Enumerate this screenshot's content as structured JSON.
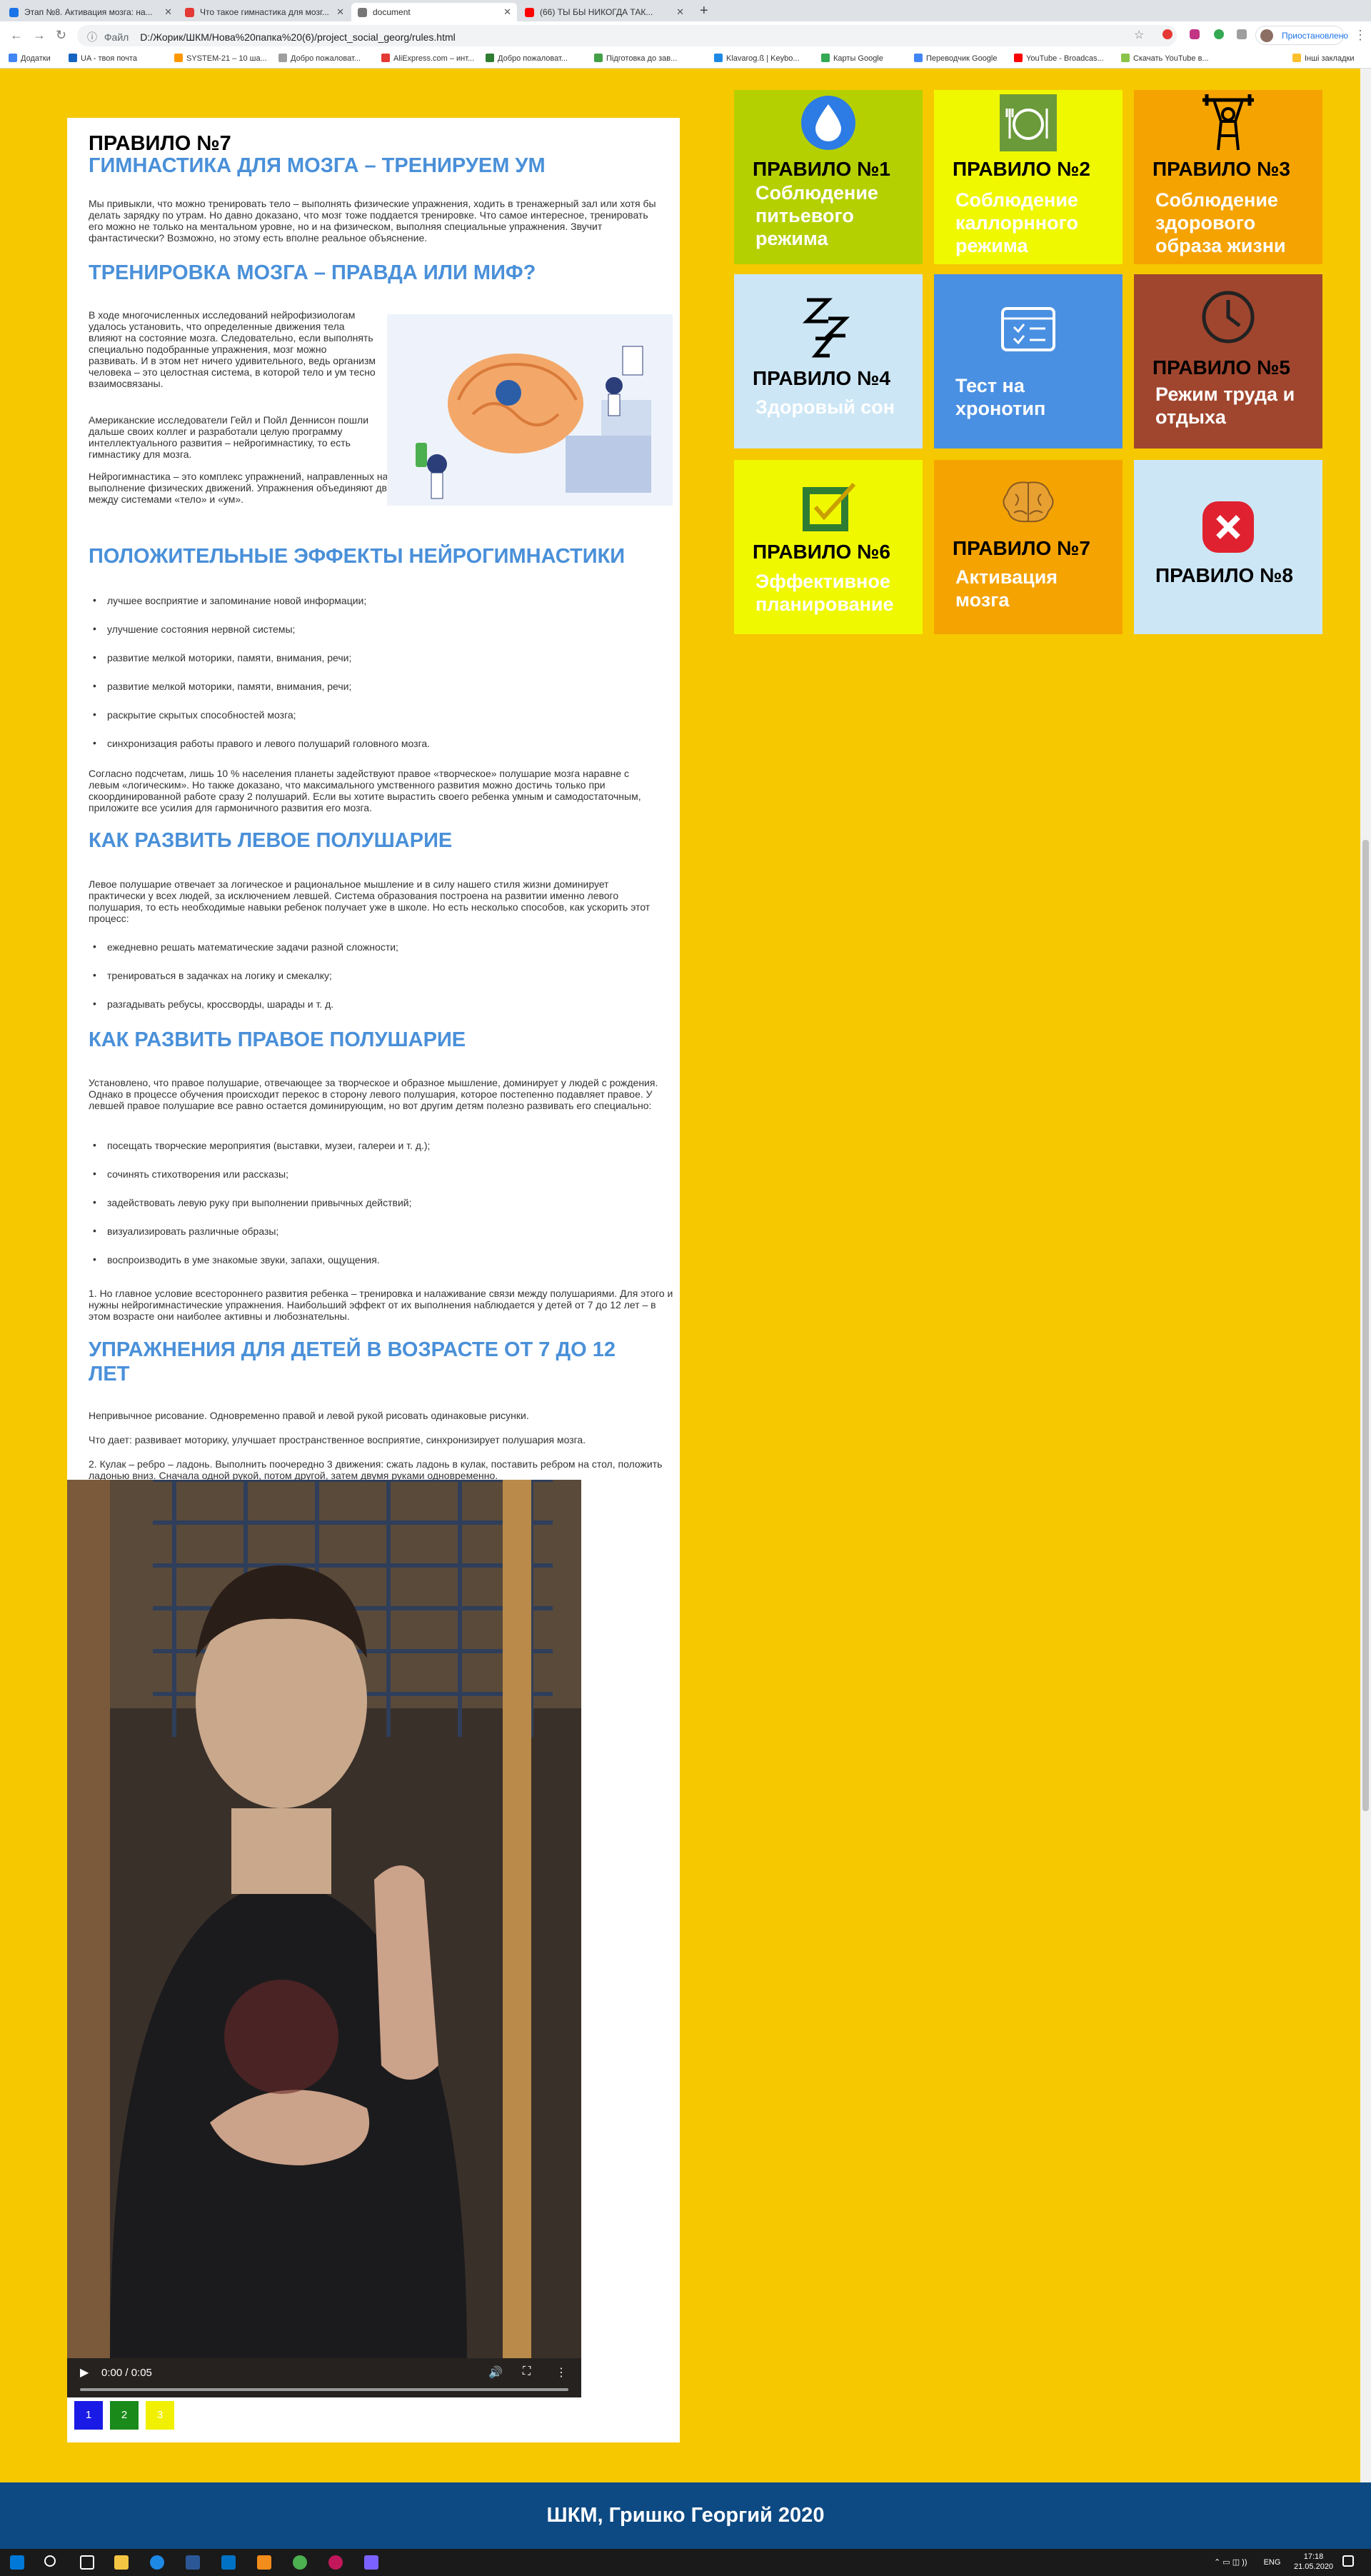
{
  "browser": {
    "tabs": [
      {
        "label": "Этап №8. Активация мозга: на...",
        "active": false,
        "color": "#1a73e8"
      },
      {
        "label": "Что такое гимнастика для мозг...",
        "active": false,
        "color": "#e53935"
      },
      {
        "label": "document",
        "active": true,
        "color": "#777777"
      },
      {
        "label": "(66) ТЫ БЫ НИКОГДА ТАК...",
        "active": false,
        "color": "#ff0000"
      }
    ],
    "new_tab": "+",
    "address_label": "Файл",
    "address": "D:/Жорик/ШКМ/Нова%20папка%20(6)/project_social_georg/rules.html",
    "profile": "Приостановлено",
    "bookmarks": [
      {
        "label": "Додатки",
        "color": "#4285f4"
      },
      {
        "label": "UA - твоя почта",
        "color": "#1565c0"
      },
      {
        "label": "SYSTEM-21 – 10 ша...",
        "color": "#ff9800"
      },
      {
        "label": "Добро пожаловат...",
        "color": "#9e9e9e"
      },
      {
        "label": "AliExpress.com – инт...",
        "color": "#e53935"
      },
      {
        "label": "Добро пожаловат...",
        "color": "#2e7d32"
      },
      {
        "label": "Підготовка до зав...",
        "color": "#43a047"
      },
      {
        "label": "Klavarog.ß | Keybo...",
        "color": "#1e88e5"
      },
      {
        "label": "Карты Google",
        "color": "#34a853"
      },
      {
        "label": "Переводчик Google",
        "color": "#4285f4"
      },
      {
        "label": "YouTube - Broadcas...",
        "color": "#ff0000"
      },
      {
        "label": "Скачать YouTube в...",
        "color": "#8bc34a"
      },
      {
        "label": "Інші закладки",
        "color": "#fbc02d"
      }
    ]
  },
  "article": {
    "rule_title": "ПРАВИЛО №7",
    "subtitle": "ГИМНАСТИКА ДЛЯ МОЗГА – ТРЕНИРУЕМ УМ",
    "intro": "Мы привыкли, что можно тренировать тело – выполнять физические упражнения, ходить в тренажерный зал или хотя бы делать зарядку по утрам. Но давно доказано, что мозг тоже поддается тренировке. Что самое интересное, тренировать его можно не только на ментальном уровне, но и на физическом, выполняя специальные упражнения. Звучит фантастически? Возможно, но этому есть вполне реальное объяснение.",
    "h_myth": "ТРЕНИРОВКА МОЗГА – ПРАВДА ИЛИ МИФ?",
    "myth_p1": "В ходе многочисленных исследований нейрофизиологам удалось установить, что определенные движения тела влияют на состояние мозга. Следовательно, если выполнять специально подобранные упражнения, мозг можно развивать. И в этом нет ничего удивительного, ведь организм человека – это целостная система, в которой тело и ум тесно взаимосвязаны.",
    "myth_p2": "Американские исследователи Гейл и Пойл Деннисон пошли дальше своих коллег и разработали целую программу интеллектуального развития – нейрогимнастику, то есть гимнастику для мозга.",
    "myth_p3": "Нейрогимнастика – это комплекс упражнений, направленных на активацию естественных механизмов работы мозга через выполнение физических движений. Упражнения объединяют движение и мысль, то есть активизируют и задействуют связи между системами «тело» и «ум».",
    "h_effects": "ПОЛОЖИТЕЛЬНЫЕ ЭФФЕКТЫ НЕЙРОГИМНАСТИКИ",
    "effects": [
      "лучшее восприятие и запоминание новой информации;",
      "улучшение состояния нервной системы;",
      "развитие мелкой моторики, памяти, внимания, речи;",
      "развитие мелкой моторики, памяти, внимания, речи;",
      "раскрытие скрытых способностей мозга;",
      "синхронизация работы правого и левого полушарий головного мозга."
    ],
    "effects_p": "Согласно подсчетам, лишь 10 % населения планеты задействуют правое «творческое» полушарие мозга наравне с левым «логическим». Но также доказано, что максимального умственного развития можно достичь только при скоординированной работе сразу 2 полушарий. Если вы хотите вырастить своего ребенка умным и самодостаточным, приложите все усилия для гармоничного развития его мозга.",
    "h_left": "КАК РАЗВИТЬ ЛЕВОЕ ПОЛУШАРИЕ",
    "left_p": "Левое полушарие отвечает за логическое и рациональное мышление и в силу нашего стиля жизни доминирует практически у всех людей, за исключением левшей. Система образования построена на развитии именно левого полушария, то есть необходимые навыки ребенок получает уже в школе. Но есть несколько способов, как ускорить этот процесс:",
    "left_items": [
      "ежедневно решать математические задачи разной сложности;",
      "тренироваться в задачках на логику и смекалку;",
      "разгадывать ребусы, кроссворды, шарады и т. д."
    ],
    "h_right": "КАК РАЗВИТЬ ПРАВОЕ ПОЛУШАРИЕ",
    "right_p": "Установлено, что правое полушарие, отвечающее за творческое и образное мышление, доминирует у людей с рождения. Однако в процессе обучения происходит перекос в сторону левого полушария, которое постепенно подавляет правое. У левшей правое полушарие все равно остается доминирующим, но вот другим детям полезно развивать его специально:",
    "right_items": [
      "посещать творческие мероприятия (выставки, музеи, галереи и т. д.);",
      "сочинять стихотворения или рассказы;",
      "задействовать левую руку при выполнении привычных действий;",
      "визуализировать различные образы;",
      "воспроизводить в уме знакомые звуки, запахи, ощущения."
    ],
    "right_note": "1. Но главное условие всестороннего развития ребенка – тренировка и налаживание связи между полушариями. Для этого и нужны нейрогимнастические упражнения. Наибольший эффект от их выполнения наблюдается у детей от 7 до 12 лет – в этом возрасте они наиболее активны и любознательны.",
    "h_exercises": "УПРАЖНЕНИЯ ДЛЯ ДЕТЕЙ В ВОЗРАСТЕ ОТ 7 ДО 12 ЛЕТ",
    "ex_p1": "Непривычное рисование. Одновременно правой и левой рукой рисовать одинаковые рисунки.",
    "ex_p2": "Что дает: развивает моторику, улучшает пространственное восприятие, синхронизирует полушария мозга.",
    "ex_p3": "2. Кулак – ребро – ладонь. Выполнить поочередно 3 движения: сжать ладонь в кулак, поставить ребром на стол, положить ладонью вниз. Сначала одной рукой, потом другой, затем двумя руками одновременно.",
    "video_time": "0:00 / 0:05",
    "pager": [
      {
        "label": "1",
        "color": "#1a1ae6"
      },
      {
        "label": "2",
        "color": "#1a8a1a"
      },
      {
        "label": "3",
        "color": "#f0f000"
      }
    ]
  },
  "tiles": [
    {
      "title": "ПРАВИЛО №1",
      "subtitle": "Соблюдение питьевого режима",
      "bg": "#b5d000",
      "icon": "water-drop-icon"
    },
    {
      "title": "ПРАВИЛО №2",
      "subtitle": "Соблюдение каллорнного режима",
      "bg": "#f0f800",
      "icon": "diet-plate-icon"
    },
    {
      "title": "ПРАВИЛО №3",
      "subtitle": "Соблюдение здорового образа жизни",
      "bg": "#f5a300",
      "icon": "weightlifter-icon"
    },
    {
      "title": "ПРАВИЛО №4",
      "subtitle": "Здоровый сон",
      "bg": "#cce6f5",
      "icon": "sleep-zzz-icon"
    },
    {
      "title": "",
      "subtitle": "Тест на хронотип",
      "bg": "#4a90e2",
      "icon": "browser-checklist-icon"
    },
    {
      "title": "ПРАВИЛО №5",
      "subtitle": "Режим труда и отдыха",
      "bg": "#a0462e",
      "icon": "clock-icon"
    },
    {
      "title": "ПРАВИЛО №6",
      "subtitle": "Эффективное планирование",
      "bg": "#f0f800",
      "icon": "checkbox-icon"
    },
    {
      "title": "ПРАВИЛО №7",
      "subtitle": "Активация мозга",
      "bg": "#f5a300",
      "icon": "brain-icon"
    },
    {
      "title": "ПРАВИЛО №8",
      "subtitle": "",
      "bg": "#cce6f5",
      "icon": "close-x-icon"
    }
  ],
  "footer": {
    "text": "ШКМ, Гришко Георгий 2020"
  },
  "taskbar": {
    "lang": "ENG",
    "time": "17:18",
    "date": "21.05.2020"
  }
}
